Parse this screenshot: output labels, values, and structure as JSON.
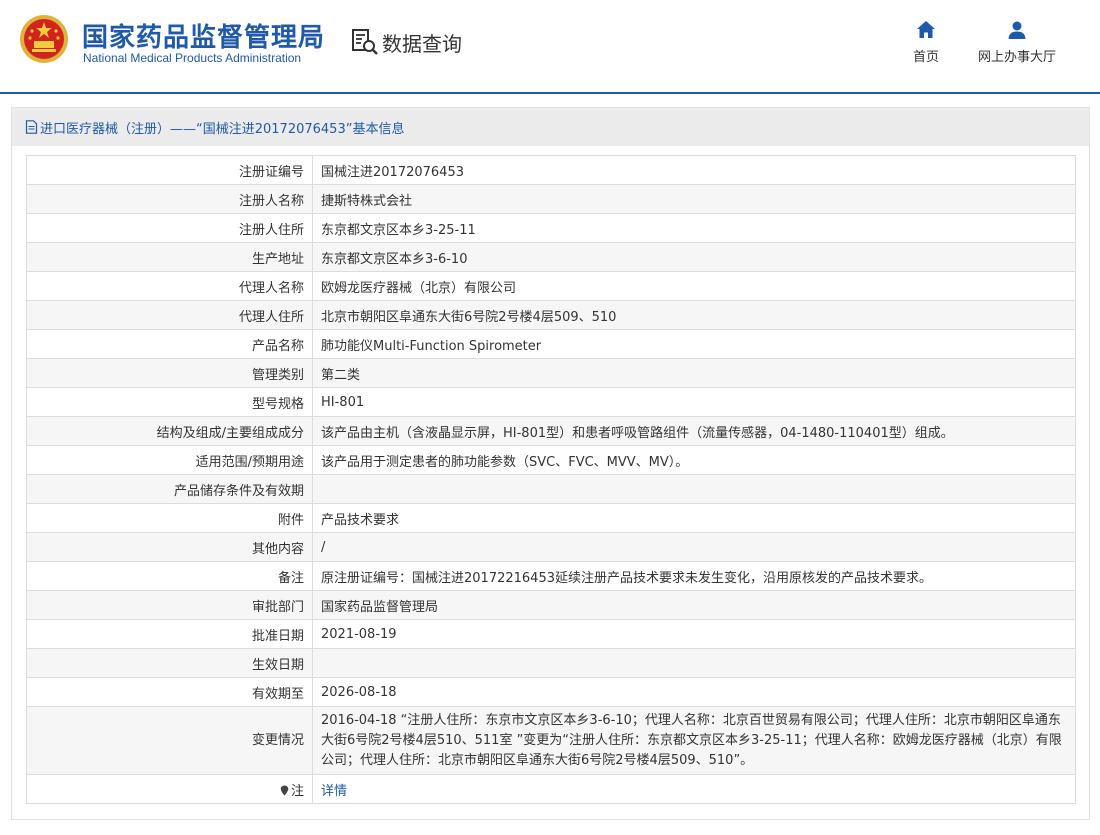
{
  "header": {
    "logo_cn": "国家药品监督管理局",
    "logo_en": "National Medical Products Administration",
    "query_label": "数据查询",
    "nav": [
      {
        "label": "首页",
        "icon": "home-icon"
      },
      {
        "label": "网上办事大厅",
        "icon": "user-icon"
      }
    ]
  },
  "panel": {
    "title": "进口医疗器械（注册）——“国械注进20172076453”基本信息",
    "rows": [
      {
        "label": "注册证编号",
        "value": "国械注进20172076453"
      },
      {
        "label": "注册人名称",
        "value": "捷斯特株式会社"
      },
      {
        "label": "注册人住所",
        "value": "东京都文京区本乡3-25-11"
      },
      {
        "label": "生产地址",
        "value": "东京都文京区本乡3-6-10"
      },
      {
        "label": "代理人名称",
        "value": "欧姆龙医疗器械（北京）有限公司"
      },
      {
        "label": "代理人住所",
        "value": "北京市朝阳区阜通东大街6号院2号楼4层509、510"
      },
      {
        "label": "产品名称",
        "value": "肺功能仪Multi-Function Spirometer"
      },
      {
        "label": "管理类别",
        "value": "第二类"
      },
      {
        "label": "型号规格",
        "value": "HI-801"
      },
      {
        "label": "结构及组成/主要组成成分",
        "value": "该产品由主机（含液晶显示屏，HI-801型）和患者呼吸管路组件（流量传感器，04-1480-110401型）组成。"
      },
      {
        "label": "适用范围/预期用途",
        "value": "该产品用于测定患者的肺功能参数（SVC、FVC、MVV、MV）。"
      },
      {
        "label": "产品储存条件及有效期",
        "value": ""
      },
      {
        "label": "附件",
        "value": "产品技术要求"
      },
      {
        "label": "其他内容",
        "value": "/"
      },
      {
        "label": "备注",
        "value": "原注册证编号：国械注进20172216453延续注册产品技术要求未发生变化，沿用原核发的产品技术要求。"
      },
      {
        "label": "审批部门",
        "value": "国家药品监督管理局"
      },
      {
        "label": "批准日期",
        "value": "2021-08-19"
      },
      {
        "label": "生效日期",
        "value": ""
      },
      {
        "label": "有效期至",
        "value": "2026-08-18"
      },
      {
        "label": "变更情况",
        "value": "2016-04-18 “注册人住所：东京市文京区本乡3-6-10；代理人名称：北京百世贸易有限公司；代理人住所：北京市朝阳区阜通东大街6号院2号楼4层510、511室 ”变更为“注册人住所：东京都文京区本乡3-25-11；代理人名称：欧姆龙医疗器械（北京）有限公司；代理人住所：北京市朝阳区阜通东大街6号院2号楼4层509、510”。"
      }
    ],
    "note_label": "注",
    "note_link": "详情"
  }
}
